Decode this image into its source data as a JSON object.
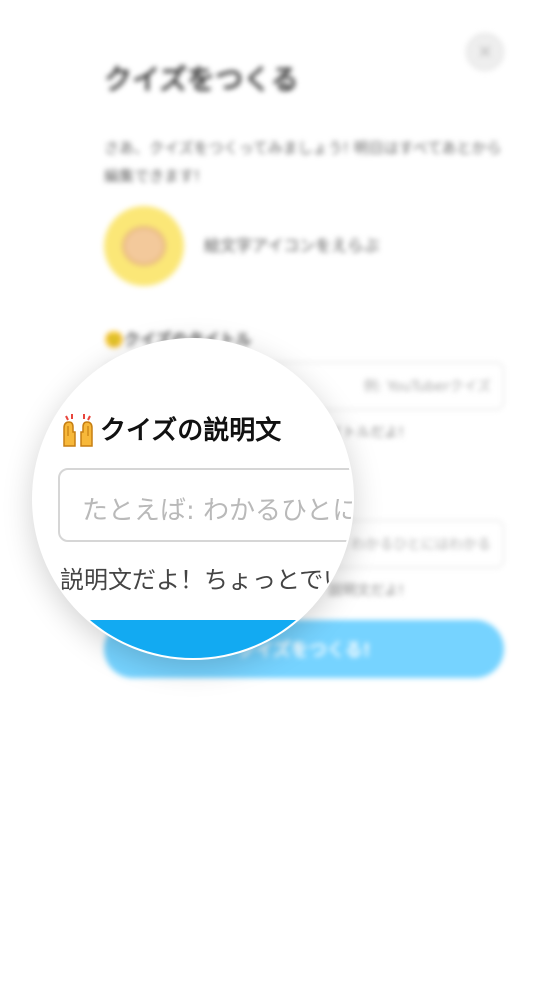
{
  "background": {
    "close_icon_glyph": "✕",
    "title": "クイズをつくる",
    "intro": "さあ、クイズをつくってみましょう! 明日はすべてあとから編集できます!",
    "avatar_label": "絵文字アイコンをえらぶ",
    "title_field_label": "🙂クイズのタイトル",
    "title_input_placeholder": "例: YouTuberクイズ",
    "title_help": "クイズのタイトルだよ!",
    "desc_input_placeholder": "たとえば: わかるひとにはわかる",
    "desc_help": "説明文だよ!",
    "create_button_label": "クイズをつくる!"
  },
  "magnifier": {
    "section_icon": "raising-hands-icon",
    "section_title": "クイズの説明文",
    "description_placeholder": "たとえば: わかるひとにはわかる",
    "description_help": "説明文だよ！ちょっとでいいよ"
  },
  "colors": {
    "accent": "#12aaf2",
    "accent_light": "#76d3ff",
    "avatar_bg": "#fbe777",
    "placeholder": "#b9b9b9"
  }
}
